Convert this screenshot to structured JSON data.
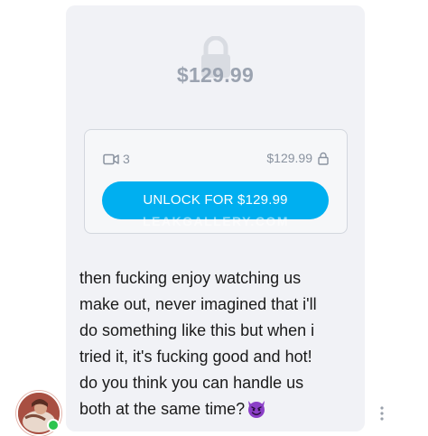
{
  "post": {
    "locked_price": "$129.99",
    "media_count": "3",
    "card_price": "$129.99",
    "unlock_label": "UNLOCK FOR $129.99",
    "watermark": "LEAKGALLERY.COM",
    "message_lines": [
      "then fucking enjoy watching us",
      "make out, never imagined that i'll",
      "do something like this but when i",
      "tried it, it's fucking good and hot!",
      "do you think you can handle us",
      "both at the same time?"
    ]
  },
  "icons": {
    "lock_large": "lock-icon",
    "video": "video-camera-icon",
    "lock_small": "lock-icon",
    "emoji": "smiling-devil-emoji",
    "more": "vertical-dots-icon"
  },
  "colors": {
    "accent": "#00aff0",
    "bubble": "#f1f2f6",
    "muted_text": "#8a93a0",
    "online": "#2cc44f"
  }
}
